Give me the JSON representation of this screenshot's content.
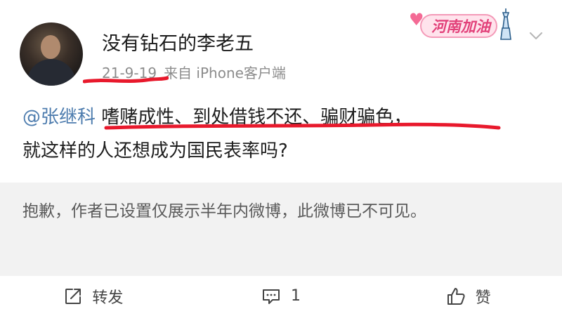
{
  "post": {
    "username": "没有钻石的李老五",
    "date": "21-9-19",
    "source": "来自 iPhone客户端",
    "mention": "@张继科",
    "text_line1": " 嗜赌成性、到处借钱不还、骗财骗色，",
    "text_line2": "就这样的人还想成为国民表率吗?",
    "badge_text": "河南加油"
  },
  "notice": {
    "text": "抱歉，作者已设置仅展示半年内微博，此微博已不可见。"
  },
  "actions": {
    "repost_label": "转发",
    "comment_count": "1",
    "like_label": "赞"
  },
  "colors": {
    "mention": "#4d7cae",
    "underline": "#e8192c",
    "badge": "#e2417a",
    "notice_bg": "#f2f2f2"
  }
}
